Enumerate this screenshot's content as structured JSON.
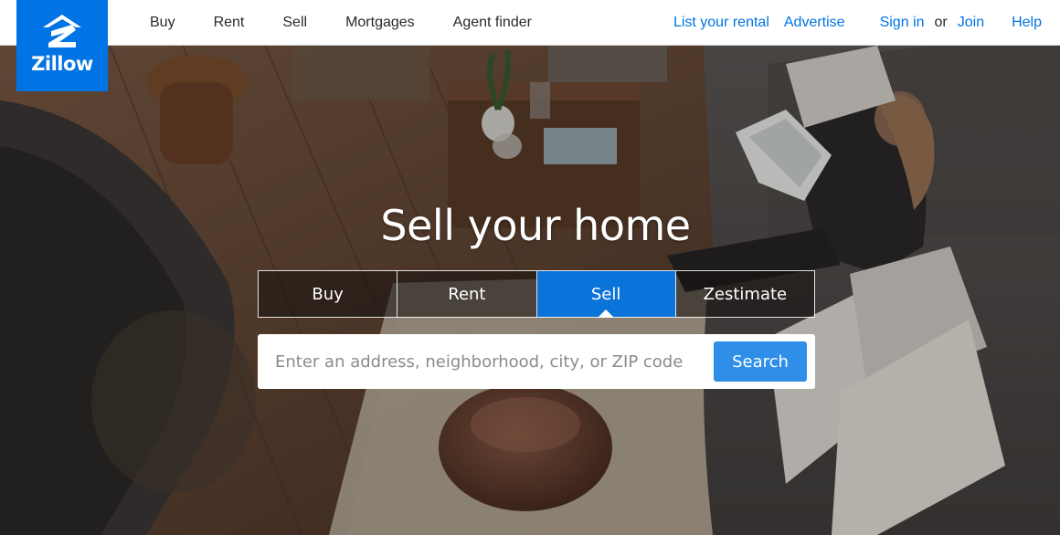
{
  "brand": {
    "name": "Zillow",
    "color": "#0074e4",
    "icon": "zillow-z-house-icon"
  },
  "nav": {
    "left": [
      "Buy",
      "Rent",
      "Sell",
      "Mortgages",
      "Agent finder"
    ],
    "right": {
      "list_rental": "List your rental",
      "advertise": "Advertise",
      "sign_in": "Sign in",
      "or": "or",
      "join": "Join",
      "help": "Help"
    }
  },
  "hero": {
    "title": "Sell your home",
    "tabs": [
      {
        "label": "Buy",
        "active": false
      },
      {
        "label": "Rent",
        "active": false
      },
      {
        "label": "Sell",
        "active": true
      },
      {
        "label": "Zestimate",
        "active": false
      }
    ],
    "search": {
      "placeholder": "Enter an address, neighborhood, city, or ZIP code",
      "value": "",
      "button": "Search"
    }
  },
  "colors": {
    "accent": "#0074e4",
    "active_tab": "#0a74da",
    "search_button": "#2f8fe8"
  }
}
